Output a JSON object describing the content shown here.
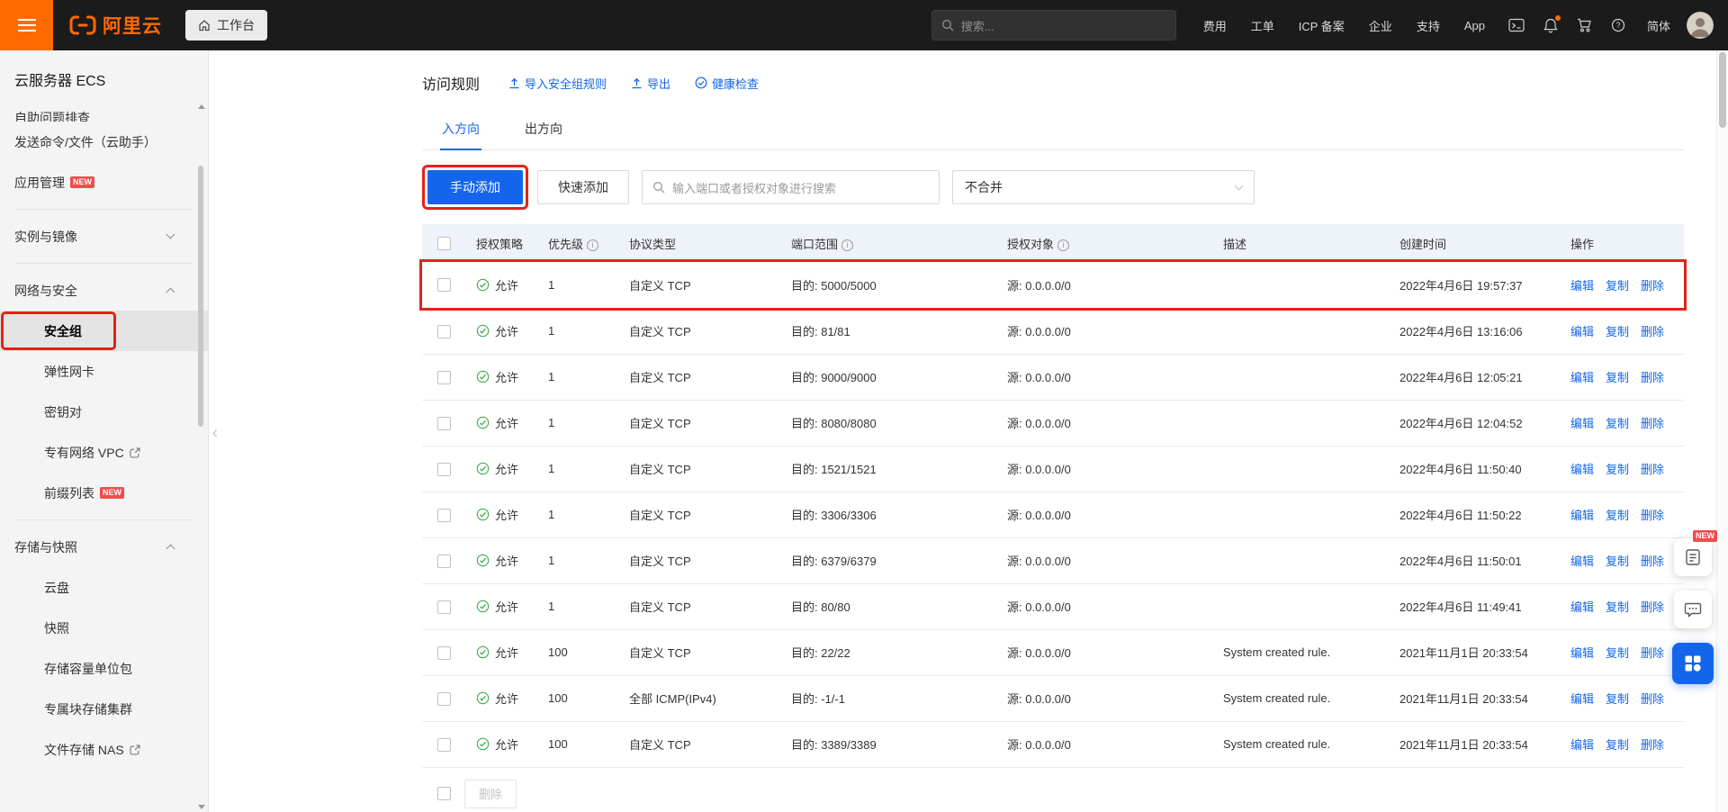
{
  "annotation_color": "#e2231a",
  "topbar": {
    "logo": "阿里云",
    "workbench": "工作台",
    "search_placeholder": "搜索...",
    "menu": [
      "费用",
      "工单",
      "ICP 备案",
      "企业",
      "支持",
      "App"
    ],
    "lang": "简体"
  },
  "sidebar": {
    "title": "云服务器 ECS",
    "items": [
      {
        "type": "item",
        "key": "self-diagnosis",
        "label": "自助问题排查",
        "clipped": true
      },
      {
        "type": "item",
        "key": "send-command",
        "label": "发送命令/文件（云助手）"
      },
      {
        "type": "item",
        "key": "app-management",
        "label": "应用管理",
        "badge": "NEW"
      },
      {
        "type": "divider"
      },
      {
        "type": "group",
        "key": "instances-images",
        "label": "实例与镜像",
        "state": "collapsed"
      },
      {
        "type": "divider"
      },
      {
        "type": "group",
        "key": "network-security",
        "label": "网络与安全",
        "state": "expanded"
      },
      {
        "type": "sub",
        "key": "security-group",
        "label": "安全组",
        "selected": true,
        "annotated": true
      },
      {
        "type": "sub",
        "key": "eni",
        "label": "弹性网卡"
      },
      {
        "type": "sub",
        "key": "key-pair",
        "label": "密钥对"
      },
      {
        "type": "sub",
        "key": "vpc",
        "label": "专有网络 VPC",
        "external": true
      },
      {
        "type": "sub",
        "key": "prefix-list",
        "label": "前缀列表",
        "badge": "NEW"
      },
      {
        "type": "divider"
      },
      {
        "type": "group",
        "key": "storage-snapshot",
        "label": "存储与快照",
        "state": "expanded"
      },
      {
        "type": "sub",
        "key": "disk",
        "label": "云盘"
      },
      {
        "type": "sub",
        "key": "snapshot",
        "label": "快照"
      },
      {
        "type": "sub",
        "key": "storage-capacity-unit",
        "label": "存储容量单位包"
      },
      {
        "type": "sub",
        "key": "dedicated-block-storage",
        "label": "专属块存储集群"
      },
      {
        "type": "sub",
        "key": "nas",
        "label": "文件存储 NAS",
        "external": true
      }
    ]
  },
  "main": {
    "title": "访问规则",
    "links": [
      {
        "key": "import-rules",
        "label": "导入安全组规则"
      },
      {
        "key": "export",
        "label": "导出"
      },
      {
        "key": "health-check",
        "label": "健康检查"
      }
    ],
    "tabs": [
      {
        "label": "入方向",
        "active": true
      },
      {
        "label": "出方向",
        "active": false
      }
    ],
    "manual_add": "手动添加",
    "quick_add": "快速添加",
    "search_placeholder": "输入端口或者授权对象进行搜索",
    "merge_value": "不合并",
    "table": {
      "headers": [
        {
          "label": "授权策略"
        },
        {
          "label": "优先级",
          "info": true
        },
        {
          "label": "协议类型"
        },
        {
          "label": "端口范围",
          "info": true
        },
        {
          "label": "授权对象",
          "info": true
        },
        {
          "label": "描述"
        },
        {
          "label": "创建时间"
        },
        {
          "label": "操作"
        }
      ],
      "actions": [
        "编辑",
        "复制",
        "删除"
      ],
      "rows": [
        {
          "policy": "允许",
          "priority": "1",
          "protocol": "自定义 TCP",
          "port": "目的: 5000/5000",
          "source": "源: 0.0.0.0/0",
          "desc": "",
          "created": "2022年4月6日 19:57:37",
          "annotated": true
        },
        {
          "policy": "允许",
          "priority": "1",
          "protocol": "自定义 TCP",
          "port": "目的: 81/81",
          "source": "源: 0.0.0.0/0",
          "desc": "",
          "created": "2022年4月6日 13:16:06"
        },
        {
          "policy": "允许",
          "priority": "1",
          "protocol": "自定义 TCP",
          "port": "目的: 9000/9000",
          "source": "源: 0.0.0.0/0",
          "desc": "",
          "created": "2022年4月6日 12:05:21"
        },
        {
          "policy": "允许",
          "priority": "1",
          "protocol": "自定义 TCP",
          "port": "目的: 8080/8080",
          "source": "源: 0.0.0.0/0",
          "desc": "",
          "created": "2022年4月6日 12:04:52"
        },
        {
          "policy": "允许",
          "priority": "1",
          "protocol": "自定义 TCP",
          "port": "目的: 1521/1521",
          "source": "源: 0.0.0.0/0",
          "desc": "",
          "created": "2022年4月6日 11:50:40"
        },
        {
          "policy": "允许",
          "priority": "1",
          "protocol": "自定义 TCP",
          "port": "目的: 3306/3306",
          "source": "源: 0.0.0.0/0",
          "desc": "",
          "created": "2022年4月6日 11:50:22"
        },
        {
          "policy": "允许",
          "priority": "1",
          "protocol": "自定义 TCP",
          "port": "目的: 6379/6379",
          "source": "源: 0.0.0.0/0",
          "desc": "",
          "created": "2022年4月6日 11:50:01"
        },
        {
          "policy": "允许",
          "priority": "1",
          "protocol": "自定义 TCP",
          "port": "目的: 80/80",
          "source": "源: 0.0.0.0/0",
          "desc": "",
          "created": "2022年4月6日 11:49:41"
        },
        {
          "policy": "允许",
          "priority": "100",
          "protocol": "自定义 TCP",
          "port": "目的: 22/22",
          "source": "源: 0.0.0.0/0",
          "desc": "System created rule.",
          "created": "2021年11月1日 20:33:54"
        },
        {
          "policy": "允许",
          "priority": "100",
          "protocol": "全部 ICMP(IPv4)",
          "port": "目的: -1/-1",
          "source": "源: 0.0.0.0/0",
          "desc": "System created rule.",
          "created": "2021年11月1日 20:33:54"
        },
        {
          "policy": "允许",
          "priority": "100",
          "protocol": "自定义 TCP",
          "port": "目的: 3389/3389",
          "source": "源: 0.0.0.0/0",
          "desc": "System created rule.",
          "created": "2021年11月1日 20:33:54"
        }
      ]
    },
    "batch_delete": "删除"
  },
  "floating": {
    "new_badge": "NEW"
  }
}
